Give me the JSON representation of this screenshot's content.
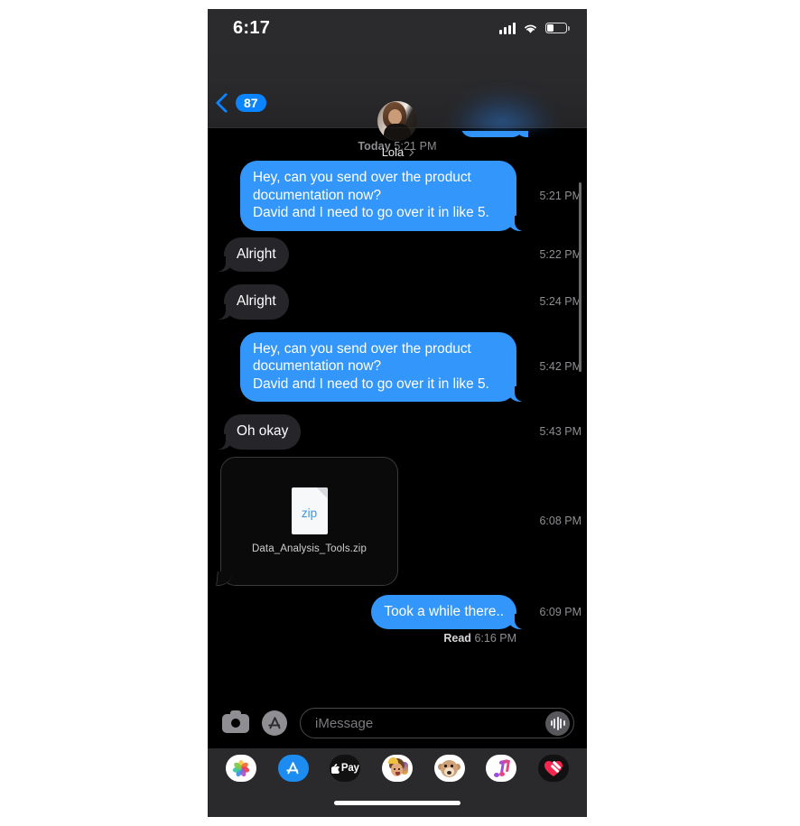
{
  "status_bar": {
    "time": "6:17",
    "cellular_icon": "cellular-bars-icon",
    "wifi_icon": "wifi-icon",
    "battery_icon": "battery-icon",
    "battery_level_pct": 32
  },
  "nav": {
    "back_badge": "87",
    "back_icon": "back-chevron-icon",
    "contact_name": "Lola",
    "contact_chevron_icon": "chevron-right-icon",
    "avatar_icon": "contact-avatar"
  },
  "thread": {
    "day_label": "Today",
    "day_time": "5:21 PM",
    "messages": [
      {
        "side": "out",
        "kind": "text",
        "text": "Hey, can you send over the product documentation now?\nDavid and I need to go over it in like 5.",
        "time": "5:21 PM"
      },
      {
        "side": "in",
        "kind": "text",
        "text": "Alright",
        "time": "5:22 PM"
      },
      {
        "side": "in",
        "kind": "text",
        "text": "Alright",
        "time": "5:24 PM"
      },
      {
        "side": "out",
        "kind": "text",
        "text": "Hey, can you send over the product documentation now?\nDavid and I need to go over it in like 5.",
        "time": "5:42 PM"
      },
      {
        "side": "in",
        "kind": "text",
        "text": "Oh okay",
        "time": "5:43 PM"
      },
      {
        "side": "in",
        "kind": "attachment",
        "file_label": "zip",
        "file_name": "Data_Analysis_Tools.zip",
        "time": "6:08 PM"
      },
      {
        "side": "out",
        "kind": "text",
        "text": "Took a while there..",
        "time": "6:09 PM"
      }
    ],
    "receipt_label": "Read",
    "receipt_time": "6:16 PM"
  },
  "composer": {
    "camera_icon": "camera-icon",
    "appstore_icon": "app-store-icon",
    "placeholder": "iMessage",
    "audio_icon": "audio-waveform-icon"
  },
  "app_drawer": {
    "apps": [
      {
        "name": "photos-app-icon",
        "label": "Photos"
      },
      {
        "name": "app-store-app-icon",
        "label": "App Store"
      },
      {
        "name": "apple-pay-app-icon",
        "label": "Pay"
      },
      {
        "name": "memoji-app-icon",
        "label": "Memoji"
      },
      {
        "name": "animoji-app-icon",
        "label": "Animoji"
      },
      {
        "name": "music-app-icon",
        "label": "Music"
      },
      {
        "name": "fitness-app-icon",
        "label": "Fitness"
      }
    ]
  },
  "home_indicator": "home-indicator",
  "colors": {
    "outgoing_bubble": "#3396fb",
    "incoming_bubble": "#26262a",
    "accent_blue": "#0a84ff",
    "timestamp_gray": "#8e8e93",
    "thread_bg": "#000000",
    "chrome_bg": "#2a2a2c"
  }
}
